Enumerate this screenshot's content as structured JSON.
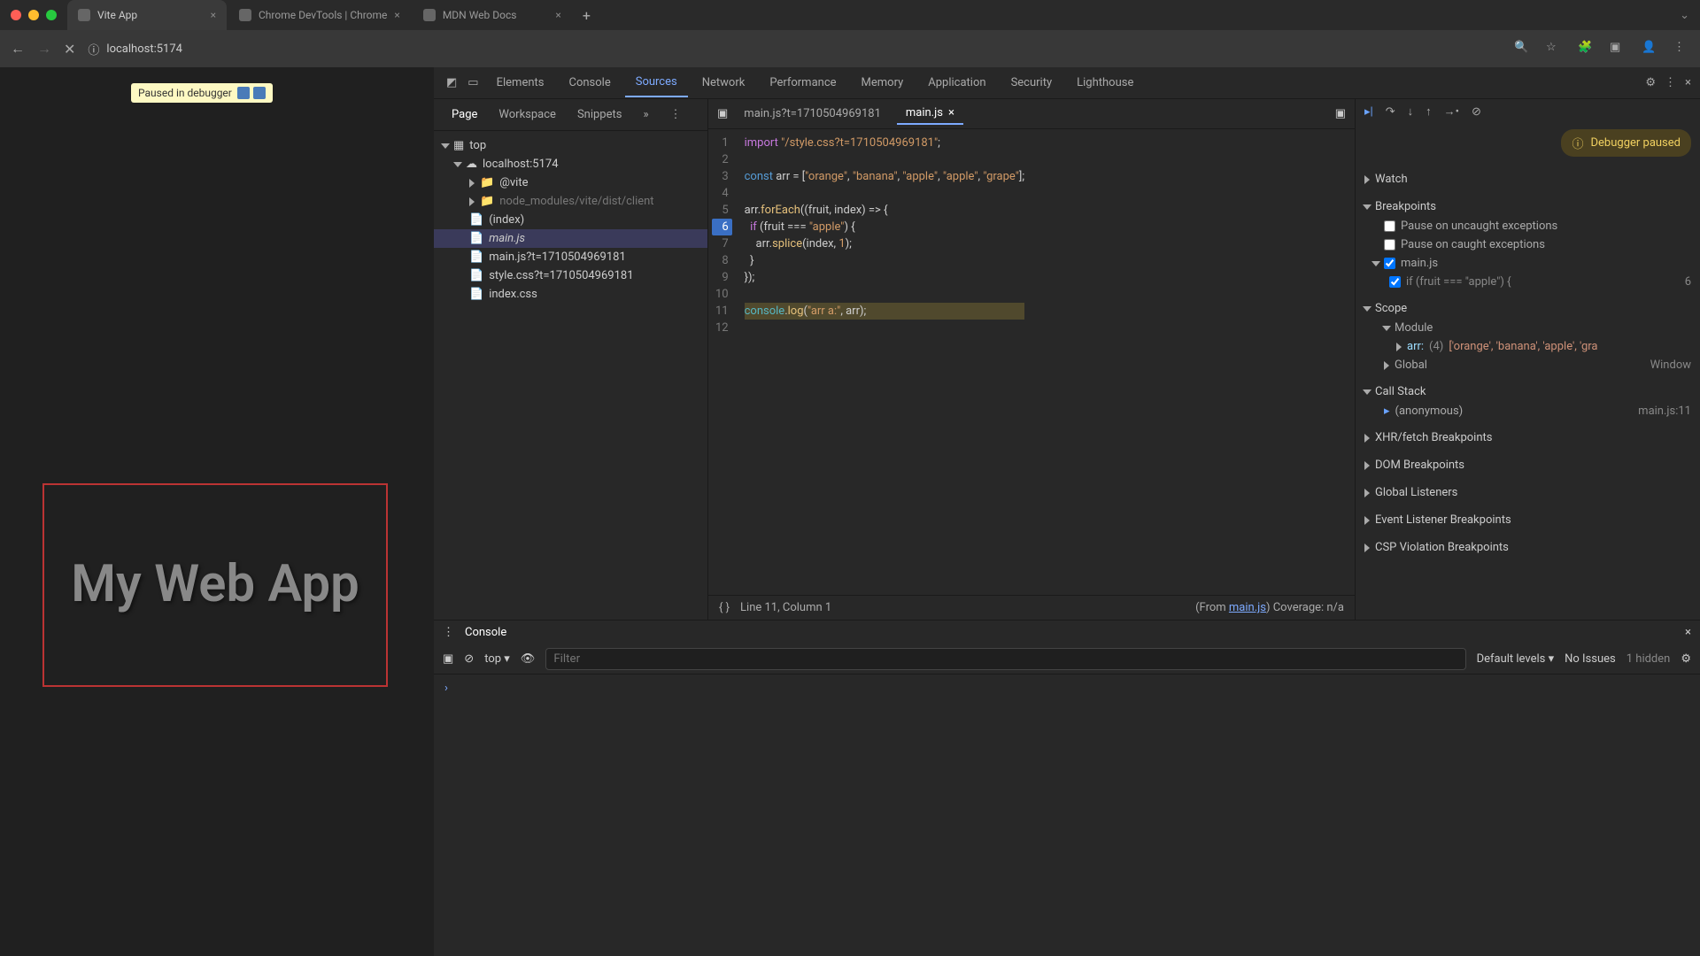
{
  "browser": {
    "tabs": [
      {
        "title": "Vite App",
        "active": true
      },
      {
        "title": "Chrome DevTools | Chrome",
        "active": false
      },
      {
        "title": "MDN Web Docs",
        "active": false
      }
    ],
    "url": "localhost:5174"
  },
  "page": {
    "paused_badge": "Paused in debugger",
    "heading": "My Web App"
  },
  "devtools": {
    "tabs": [
      "Elements",
      "Console",
      "Sources",
      "Network",
      "Performance",
      "Memory",
      "Application",
      "Security",
      "Lighthouse"
    ],
    "active_tab": "Sources"
  },
  "navigator": {
    "tabs": [
      "Page",
      "Workspace",
      "Snippets"
    ],
    "tree": {
      "top": "top",
      "host": "localhost:5174",
      "vite": "@vite",
      "node_modules": "node_modules/vite/dist/client",
      "files": [
        "(index)",
        "main.js",
        "main.js?t=1710504969181",
        "style.css?t=1710504969181",
        "index.css"
      ]
    }
  },
  "editor": {
    "open_tabs": [
      "main.js?t=1710504969181",
      "main.js"
    ],
    "active_tab": "main.js",
    "lines": [
      "import \"/style.css?t=1710504969181\";",
      "",
      "const arr = [\"orange\", \"banana\", \"apple\", \"apple\", \"grape\"];",
      "",
      "arr.forEach((fruit, index) => {",
      "  if (fruit === \"apple\") {",
      "    arr.splice(index, 1);",
      "  }",
      "});",
      "",
      "console.log(\"arr a:\", arr);",
      ""
    ],
    "breakpoint_line": 6,
    "highlight_line": 11,
    "footer_left": "Line 11, Column 1",
    "footer_from": "(From ",
    "footer_link": "main.js",
    "footer_right": ")  Coverage: n/a"
  },
  "debugger": {
    "paused_label": "Debugger paused",
    "sections": {
      "watch": "Watch",
      "breakpoints": "Breakpoints",
      "scope": "Scope",
      "callstack": "Call Stack",
      "xhr": "XHR/fetch Breakpoints",
      "dom": "DOM Breakpoints",
      "global_listeners": "Global Listeners",
      "event": "Event Listener Breakpoints",
      "csp": "CSP Violation Breakpoints"
    },
    "pause_uncaught": "Pause on uncaught exceptions",
    "pause_caught": "Pause on caught exceptions",
    "bp_file": "main.js",
    "bp_code": "if (fruit === \"apple\") {",
    "bp_line": "6",
    "scope_module": "Module",
    "scope_arr_label": "arr:",
    "scope_arr_count": "(4)",
    "scope_arr_val": "['orange', 'banana', 'apple', 'gra",
    "scope_global": "Global",
    "scope_global_val": "Window",
    "callstack_frame": "(anonymous)",
    "callstack_loc": "main.js:11"
  },
  "console": {
    "tab": "Console",
    "context": "top",
    "filter_placeholder": "Filter",
    "levels": "Default levels",
    "issues": "No Issues",
    "hidden": "1 hidden"
  }
}
